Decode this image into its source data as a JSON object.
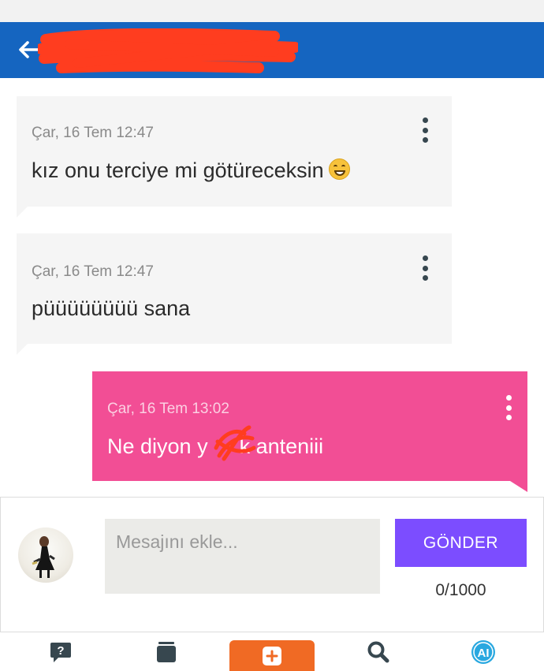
{
  "header": {
    "back_icon": "arrow-left-icon",
    "title_redacted": true,
    "background": "#1565c0"
  },
  "messages": [
    {
      "direction": "incoming",
      "date": "Çar, 16 Tem 12:47",
      "text": "kız onu terciye mi götüreceksin",
      "emoji": "grinning-face-icon"
    },
    {
      "direction": "incoming",
      "date": "Çar, 16 Tem 12:47",
      "text": "püüüüüüüü sana"
    },
    {
      "direction": "outgoing",
      "date": "Çar, 16 Tem 13:02",
      "text_before": "Ne diyon y",
      "text_after": "k anteniii",
      "redaction_color": "#ff3d1f"
    }
  ],
  "composer": {
    "placeholder": "Mesajını ekle...",
    "value": "",
    "send_label": "GÖNDER",
    "counter": "0/1000"
  },
  "bottom_nav": [
    {
      "icon": "question-bubble-icon"
    },
    {
      "icon": "cards-icon"
    },
    {
      "icon": "plus-icon",
      "accent": "#f06a24"
    },
    {
      "icon": "search-icon"
    },
    {
      "icon": "ai-icon",
      "accent": "#29a8e0"
    }
  ],
  "colors": {
    "incoming_bubble": "#f5f5f5",
    "outgoing_bubble": "#f24e95",
    "send_button": "#7c4dff"
  }
}
